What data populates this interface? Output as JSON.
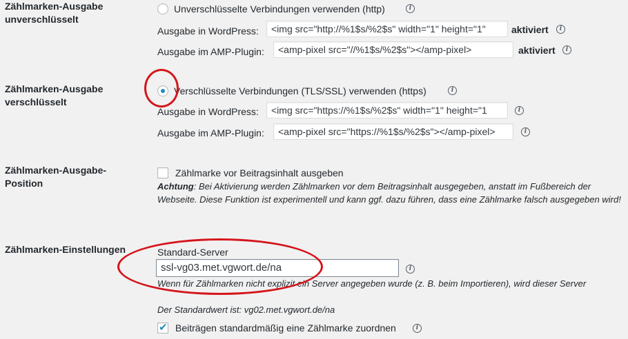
{
  "sections": {
    "unencrypted": {
      "label": "Zählmarken-Ausgabe unverschlüsselt",
      "radio_label": "Unverschlüsselte Verbindungen verwenden (http)",
      "wp_label": "Ausgabe in WordPress:",
      "wp_value": "<img src=\"http://%1$s/%2$s\" width=\"1\" height=\"1\"",
      "wp_status": "aktiviert",
      "amp_label": "Ausgabe im AMP-Plugin:",
      "amp_value": "<amp-pixel src=\"//%1$s/%2$s\"></amp-pixel>",
      "amp_status": "aktiviert"
    },
    "encrypted": {
      "label": "Zählmarken-Ausgabe verschlüsselt",
      "radio_label": "Verschlüsselte Verbindungen (TLS/SSL) verwenden (https)",
      "wp_label": "Ausgabe in WordPress:",
      "wp_value": "<img src=\"https://%1$s/%2$s\" width=\"1\" height=\"1",
      "amp_label": "Ausgabe im AMP-Plugin:",
      "amp_value": "<amp-pixel src=\"https://%1$s/%2$s\"></amp-pixel>"
    },
    "position": {
      "label": "Zählmarken-Ausgabe-Position",
      "checkbox_label": "Zählmarke vor Beitragsinhalt ausgeben",
      "desc_strong": "Achtung",
      "desc_rest": ": Bei Aktivierung werden Zählmarken vor dem Beitragsinhalt ausgegeben, anstatt im Fußbereich der Webseite. Diese Funktion ist experimentell und kann ggf. dazu führen, dass eine Zählmarke falsch ausgegeben wird!"
    },
    "settings": {
      "label": "Zählmarken-Einstellungen",
      "server_label": "Standard-Server",
      "server_value": "ssl-vg03.met.vgwort.de/na",
      "server_desc": "Wenn für Zählmarken nicht explizit ein Server angegeben wurde (z. B. beim Importieren), wird dieser Server verwendet.",
      "server_default": "Der Standardwert ist: vg02.met.vgwort.de/na",
      "assign_label": "Beiträgen standardmäßig eine Zählmarke zuordnen"
    }
  },
  "info_glyph": "i",
  "colors": {
    "accent": "#1e8cbe",
    "annotation": "#d4151b"
  }
}
